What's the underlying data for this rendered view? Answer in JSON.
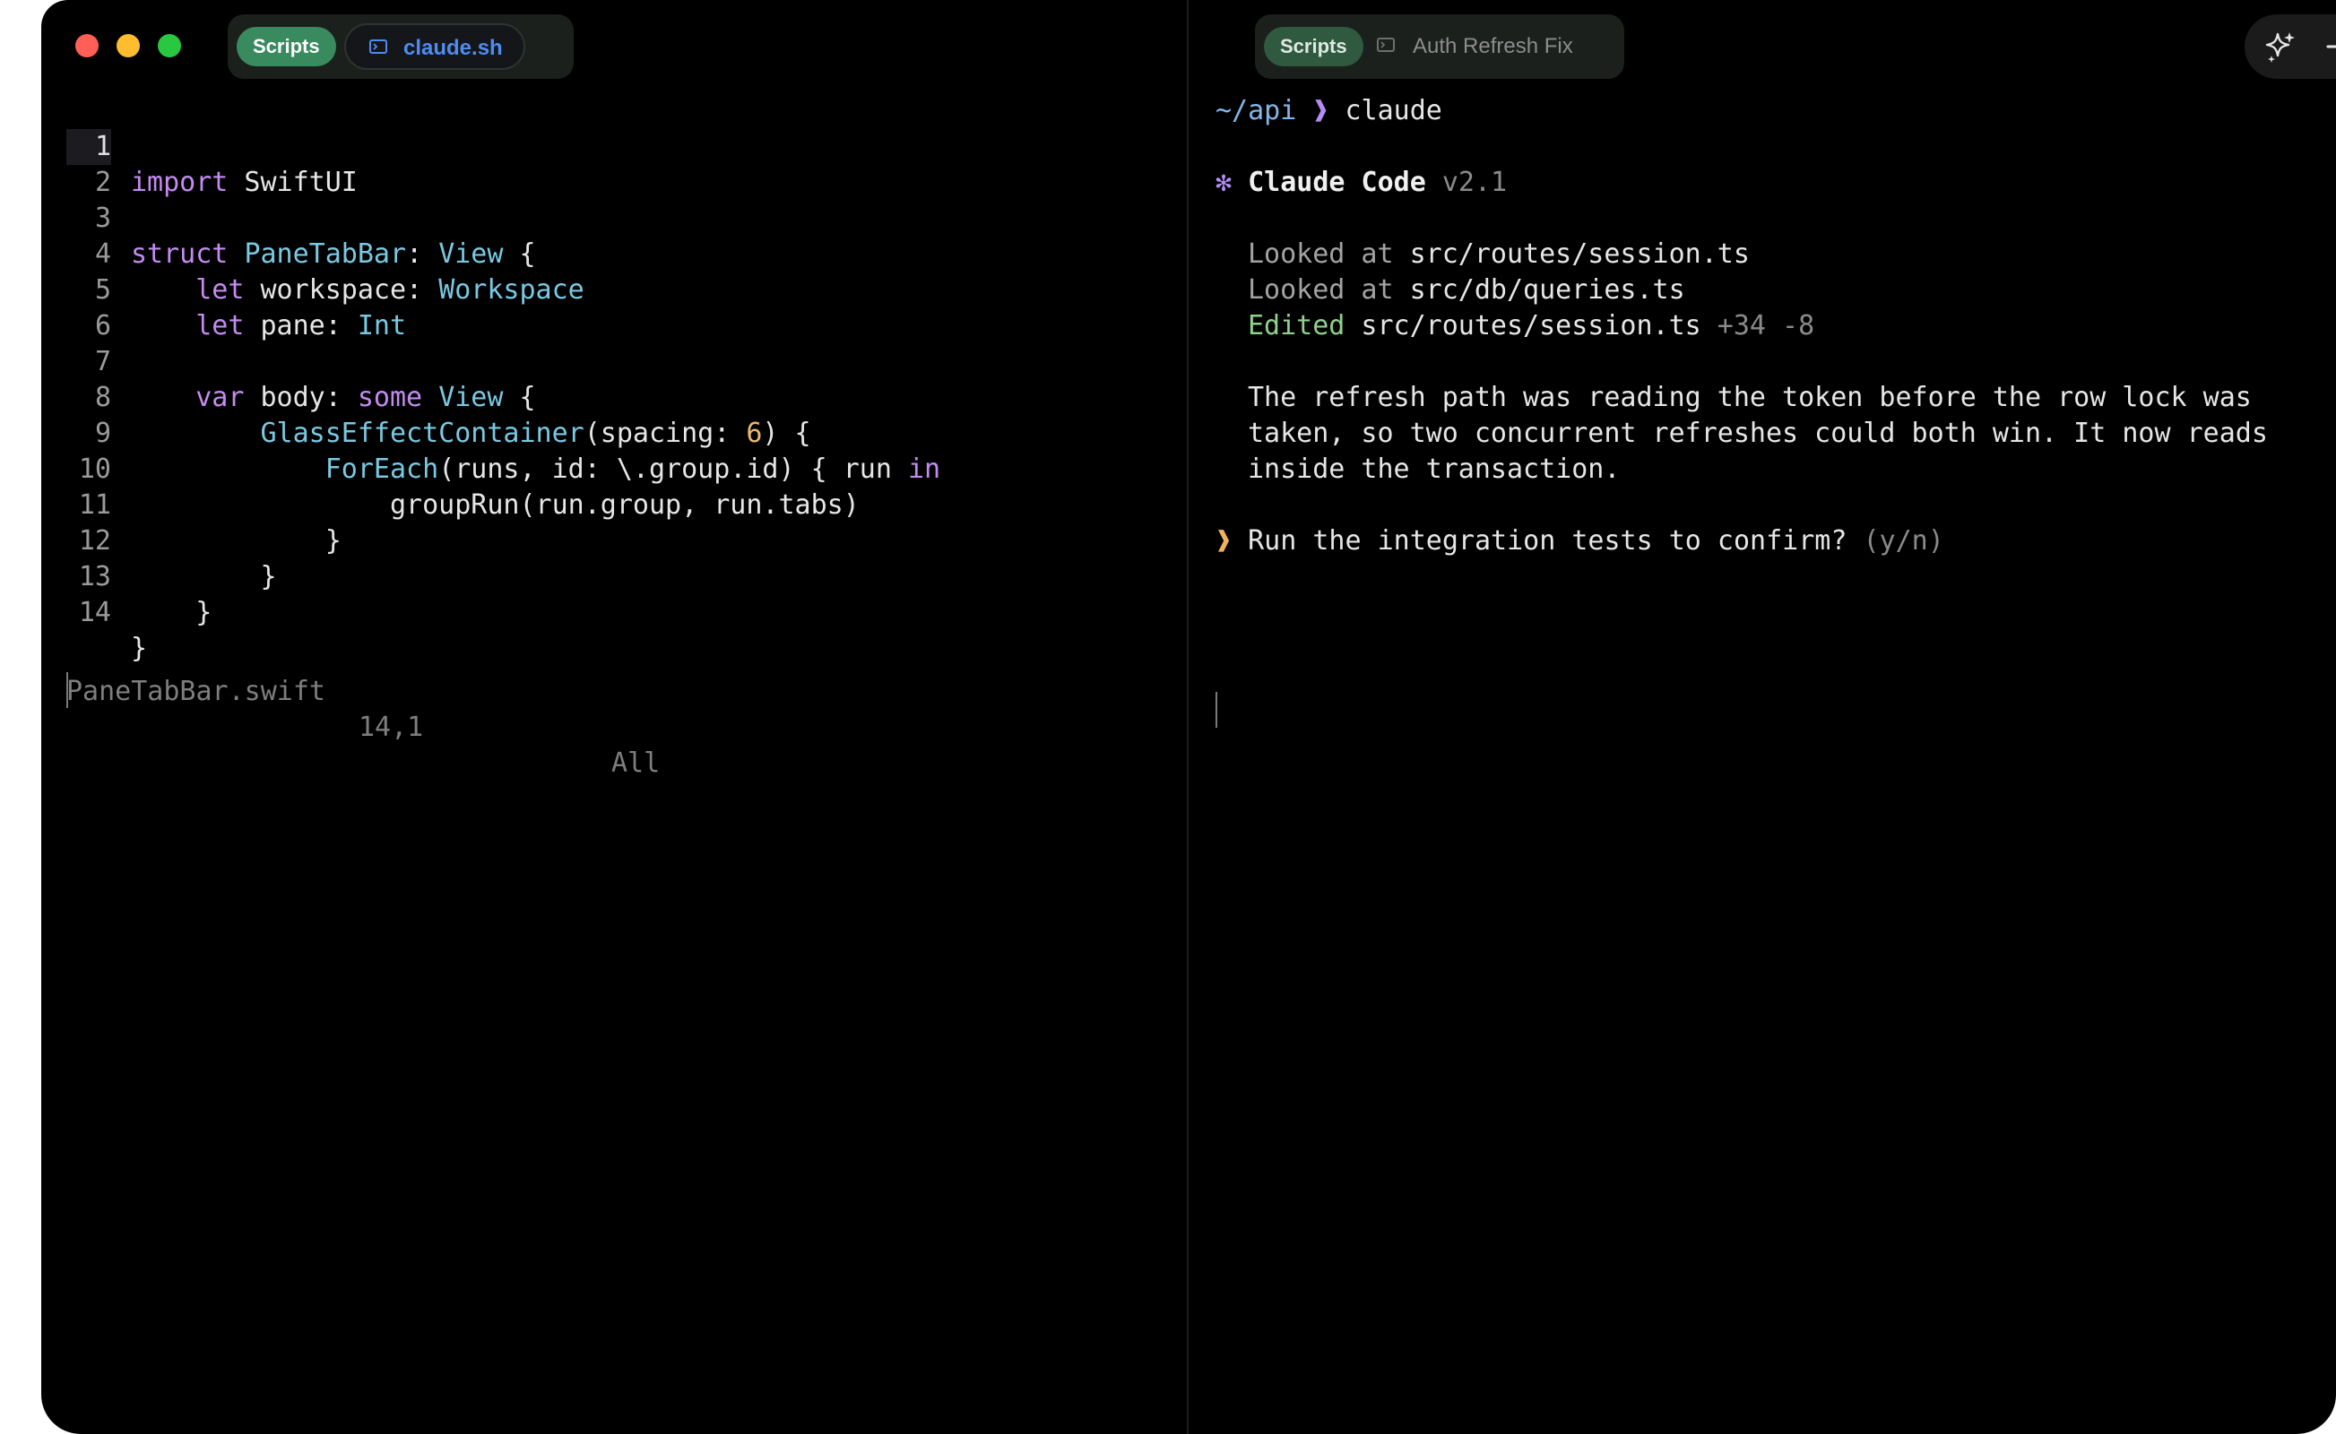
{
  "left_pane": {
    "window_controls": [
      "close",
      "minimize",
      "maximize"
    ],
    "tab_group_label": "Scripts",
    "active_tab": {
      "label": "claude.sh",
      "icon": "terminal-icon"
    },
    "editor": {
      "lines": [
        {
          "number": "1"
        },
        {
          "number": "2"
        },
        {
          "number": "3"
        },
        {
          "number": "4"
        },
        {
          "number": "5"
        },
        {
          "number": "6"
        },
        {
          "number": "7"
        },
        {
          "number": "8"
        },
        {
          "number": "9"
        },
        {
          "number": "10"
        },
        {
          "number": "11"
        },
        {
          "number": "12"
        },
        {
          "number": "13"
        },
        {
          "number": "14"
        }
      ],
      "tokens": {
        "l1_kw": "import",
        "l1_txt": " SwiftUI",
        "l3_kw": "struct",
        "l3_sp": " ",
        "l3_ty1": "PaneTabBar",
        "l3_colon": ": ",
        "l3_ty2": "View",
        "l3_brace": " {",
        "l4_ind": "    ",
        "l4_kw": "let",
        "l4_txt": " workspace: ",
        "l4_ty": "Workspace",
        "l5_ind": "    ",
        "l5_kw": "let",
        "l5_txt": " pane: ",
        "l5_ty": "Int",
        "l7_ind": "    ",
        "l7_kw": "var",
        "l7_txt": " body: ",
        "l7_kw2": "some",
        "l7_sp": " ",
        "l7_ty": "View",
        "l7_brace": " {",
        "l8_ind": "        ",
        "l8_ty": "GlassEffectContainer",
        "l8_txt": "(spacing: ",
        "l8_num": "6",
        "l8_end": ") {",
        "l9_ind": "            ",
        "l9_ty": "ForEach",
        "l9_txt": "(runs, id: \\.group.id) { run ",
        "l9_kw": "in",
        "l10_txt": "                groupRun(run.group, run.tabs)",
        "l11_txt": "            }",
        "l12_txt": "        }",
        "l13_txt": "    }",
        "l14_txt": "}"
      },
      "status": {
        "file": "PaneTabBar.swift",
        "position": "14,1",
        "scroll": "All"
      }
    }
  },
  "right_pane": {
    "tab_group_label": "Scripts",
    "tab": {
      "label": "Auth Refresh Fix",
      "icon": "terminal-icon"
    },
    "toolbar": {
      "sparkle_icon": "sparkle-icon",
      "plus_icon": "plus-icon"
    },
    "terminal": {
      "prompt_path": "~/api",
      "prompt_arrow": "❱",
      "command": " claude",
      "cc_star": "✻",
      "cc_title": " Claude Code",
      "cc_version": " v2.1",
      "actions": [
        {
          "verb": "Looked at",
          "target": " src/routes/session.ts",
          "diff": ""
        },
        {
          "verb": "Looked at",
          "target": " src/db/queries.ts",
          "diff": ""
        },
        {
          "verb": "Edited",
          "target": " src/routes/session.ts",
          "diff": " +34 -8"
        }
      ],
      "message_lines": [
        "The refresh path was reading the token before the row lock was",
        "taken, so two concurrent refreshes could both win. It now reads",
        "inside the transaction."
      ],
      "question_arrow": "❱",
      "question": " Run the integration tests to confirm?",
      "question_hint": " (y/n)"
    }
  },
  "colors": {
    "background": "#000000",
    "keyword": "#c38bf0",
    "type": "#79c9e2",
    "number": "#e8b96a",
    "accent_blue": "#4e8cf0",
    "scripts_green": "#3a8a5f",
    "edited_green": "#8ed28c",
    "prompt_arrow": "#f0b35c"
  }
}
